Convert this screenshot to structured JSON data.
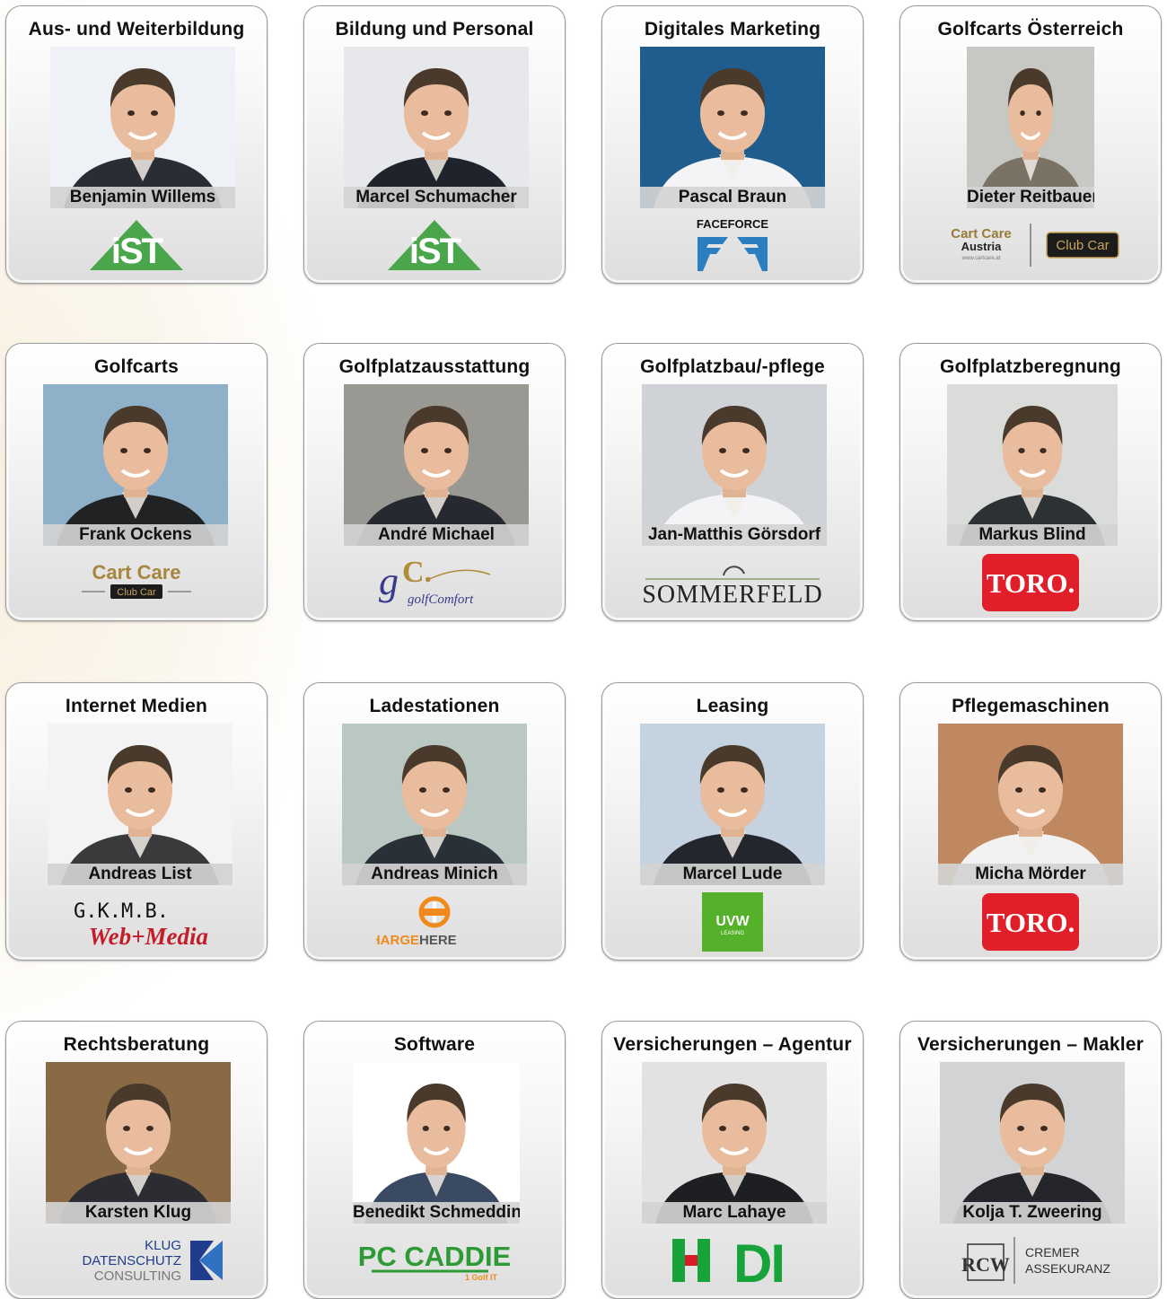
{
  "cards": [
    {
      "category": "Aus- und Weiterbildung",
      "person": "Benjamin Willems",
      "logo": {
        "kind": "ist",
        "icon": "ist-logo-icon"
      },
      "photo_colors": [
        "#eef1f5",
        "#2b2d35"
      ]
    },
    {
      "category": "Bildung und Personal",
      "person": "Marcel Schumacher",
      "logo": {
        "kind": "ist",
        "icon": "ist-logo-icon"
      },
      "photo_colors": [
        "#e6e8eb",
        "#1f232b"
      ]
    },
    {
      "category": "Digitales Marketing",
      "person": "Pascal Braun",
      "logo": {
        "kind": "faceforce",
        "text": "FACEFORCE",
        "icon": "faceforce-logo-icon"
      },
      "photo_colors": [
        "#1f5d8e",
        "#f4f4f6"
      ]
    },
    {
      "category": "Golfcarts Österreich",
      "person": "Dieter Reitbauer",
      "logo": {
        "kind": "cartcare-austria",
        "line1": "Cart Care",
        "line2": "Austria",
        "url": "www.cartcare.at",
        "badge": "Club Car",
        "icon": "cart-care-austria-logo-icon"
      },
      "photo_colors": [
        "#c7c8c3",
        "#7b7266"
      ]
    },
    {
      "category": "Golfcarts",
      "person": "Frank Ockens",
      "logo": {
        "kind": "cartcare",
        "text": "Cart Care",
        "badge": "Club Car",
        "icon": "cart-care-logo-icon"
      },
      "photo_colors": [
        "#8fb0c9",
        "#202224"
      ]
    },
    {
      "category": "Golfplatzausstattung",
      "person": "André Michael",
      "logo": {
        "kind": "golfcomfort",
        "text": "golfComfort",
        "icon": "golfcomfort-logo-icon"
      },
      "photo_colors": [
        "#9a9893",
        "#262a30"
      ]
    },
    {
      "category": "Golfplatzbau/-pflege",
      "person": "Jan-Matthis Görsdorf",
      "logo": {
        "kind": "sommerfeld",
        "text": "SOMMERFELD",
        "icon": "sommerfeld-logo-icon"
      },
      "photo_colors": [
        "#cfd3d7",
        "#f4f4f6"
      ]
    },
    {
      "category": "Golfplatzberegnung",
      "person": "Markus Blind",
      "logo": {
        "kind": "toro",
        "text": "TORO.",
        "icon": "toro-logo-icon"
      },
      "photo_colors": [
        "#d9dcd8",
        "#2c3134"
      ]
    },
    {
      "category": "Internet Medien",
      "person": "Andreas List",
      "logo": {
        "kind": "gkmb",
        "line1": "G.K.M.B.",
        "line2": "Web+Media",
        "icon": "gkmb-logo-icon"
      },
      "photo_colors": [
        "#f3f3f3",
        "#3a3a3c"
      ]
    },
    {
      "category": "Ladestationen",
      "person": "Andreas Minich",
      "logo": {
        "kind": "chargehere",
        "text1": "CHARGE",
        "text2": "HERE",
        "icon": "chargehere-logo-icon"
      },
      "photo_colors": [
        "#b9c8c2",
        "#2a3038"
      ]
    },
    {
      "category": "Leasing",
      "person": "Marcel Lude",
      "logo": {
        "kind": "uvw",
        "line1": "UVW",
        "line2": "LEASING",
        "icon": "uvw-leasing-logo-icon"
      },
      "photo_colors": [
        "#c5d3e0",
        "#23262c"
      ]
    },
    {
      "category": "Pflegemaschinen",
      "person": "Micha Mörder",
      "logo": {
        "kind": "toro",
        "text": "TORO.",
        "icon": "toro-logo-icon"
      },
      "photo_colors": [
        "#c08860",
        "#f2f2f2"
      ]
    },
    {
      "category": "Rechtsberatung",
      "person": "Karsten Klug",
      "logo": {
        "kind": "klug",
        "line1": "KLUG",
        "line2": "DATENSCHUTZ",
        "line3": "CONSULTING",
        "icon": "klug-logo-icon"
      },
      "photo_colors": [
        "#8a6a45",
        "#2b2d33"
      ]
    },
    {
      "category": "Software",
      "person": "Benedikt Schmedding",
      "logo": {
        "kind": "pccaddie",
        "text": "PC CADDIE",
        "sub": "1 Golf IT",
        "icon": "pc-caddie-logo-icon"
      },
      "photo_colors": [
        "#ffffff",
        "#3a4a63"
      ]
    },
    {
      "category": "Versicherungen – Agentur",
      "person": "Marc Lahaye",
      "logo": {
        "kind": "hdi",
        "text": "HDI",
        "icon": "hdi-logo-icon"
      },
      "photo_colors": [
        "#e2e2e2",
        "#1e1f22"
      ]
    },
    {
      "category": "Versicherungen – Makler",
      "person": "Kolja T. Zweering",
      "logo": {
        "kind": "cremer",
        "line1": "CREMER",
        "line2": "ASSEKURANZ",
        "monogram": "RCW",
        "icon": "cremer-assekuranz-logo-icon"
      },
      "photo_colors": [
        "#d2d3d5",
        "#24262b"
      ]
    }
  ]
}
